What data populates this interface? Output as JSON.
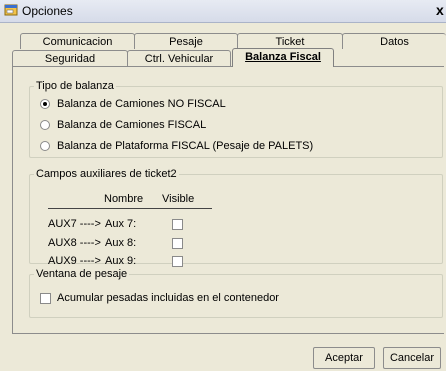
{
  "window": {
    "title": "Opciones",
    "close_glyph": "x",
    "icon": "window-app-icon"
  },
  "tabs": {
    "row_back": [
      "Comunicacion",
      "Pesaje",
      "Ticket",
      "Datos"
    ],
    "row_front": [
      "Seguridad",
      "Ctrl. Vehicular",
      "Balanza Fiscal"
    ],
    "active": "Balanza Fiscal"
  },
  "tipo_balanza": {
    "legend": "Tipo de balanza",
    "options": [
      {
        "label": "Balanza de Camiones NO FISCAL",
        "selected": true
      },
      {
        "label": "Balanza de Camiones FISCAL",
        "selected": false
      },
      {
        "label": "Balanza de Plataforma FISCAL (Pesaje de PALETS)",
        "selected": false
      }
    ]
  },
  "campos_auxiliares": {
    "legend": "Campos auxiliares de ticket2",
    "col_nombre": "Nombre",
    "col_visible": "Visible",
    "rows": [
      {
        "field": "AUX7 ---->",
        "name": "Aux 7:",
        "visible": false
      },
      {
        "field": "AUX8 ---->",
        "name": "Aux 8:",
        "visible": false
      },
      {
        "field": "AUX9 ---->",
        "name": "Aux 9:",
        "visible": false
      }
    ]
  },
  "ventana_pesaje": {
    "legend": "Ventana de pesaje",
    "checkbox_label": "Acumular pesadas incluidas en el contenedor",
    "checked": false
  },
  "buttons": {
    "accept": "Aceptar",
    "cancel": "Cancelar"
  }
}
